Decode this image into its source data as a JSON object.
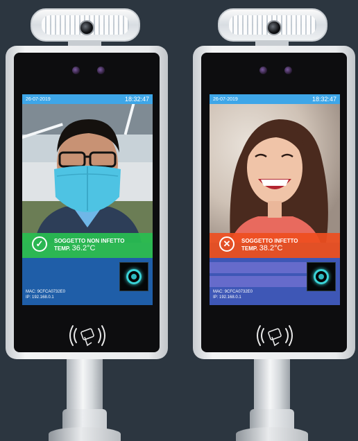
{
  "devices": [
    {
      "date": "26-07-2019",
      "time": "18:32:47",
      "result_icon": "check-circle-icon",
      "result_status": "SOGGETTO NON INFETTO",
      "temp_label": "TEMP.",
      "temp_value": "36.2°C",
      "mac": "MAC: 9CFCA0732E0",
      "ip": "IP: 192.168.0.1",
      "accent": "#2fbe50"
    },
    {
      "date": "26-07-2019",
      "time": "18:32:47",
      "result_icon": "x-circle-icon",
      "result_status": "SOGGETTO INFETTO",
      "temp_label": "TEMP.",
      "temp_value": "38.2°C",
      "mac": "MAC: 9CFCA0732E0",
      "ip": "IP: 192.168.0.1",
      "accent": "#ee4e20"
    }
  ],
  "colors": {
    "status_bar": "#3ea6e8",
    "background": "#2c3640"
  }
}
